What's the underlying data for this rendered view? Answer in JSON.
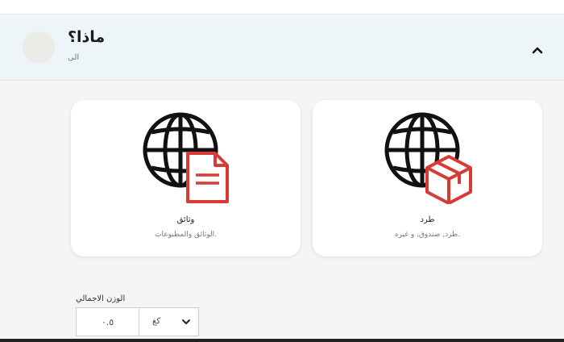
{
  "header": {
    "title": "ماذا؟",
    "subtitle": "الى"
  },
  "cards": [
    {
      "title": "وثائق",
      "description": "الوثائق والمطبوعات.",
      "icon": "globe-document-icon"
    },
    {
      "title": "طرد",
      "description": "طرد, صندوق, و غيره.",
      "icon": "globe-box-icon"
    }
  ],
  "weight": {
    "label": "الوزن الاجمالي",
    "value": "٠.٥",
    "unit": "كغ"
  },
  "colors": {
    "accent": "#d83a35",
    "header_bg": "#eef5f8",
    "page_bg": "#f5f5f5"
  }
}
